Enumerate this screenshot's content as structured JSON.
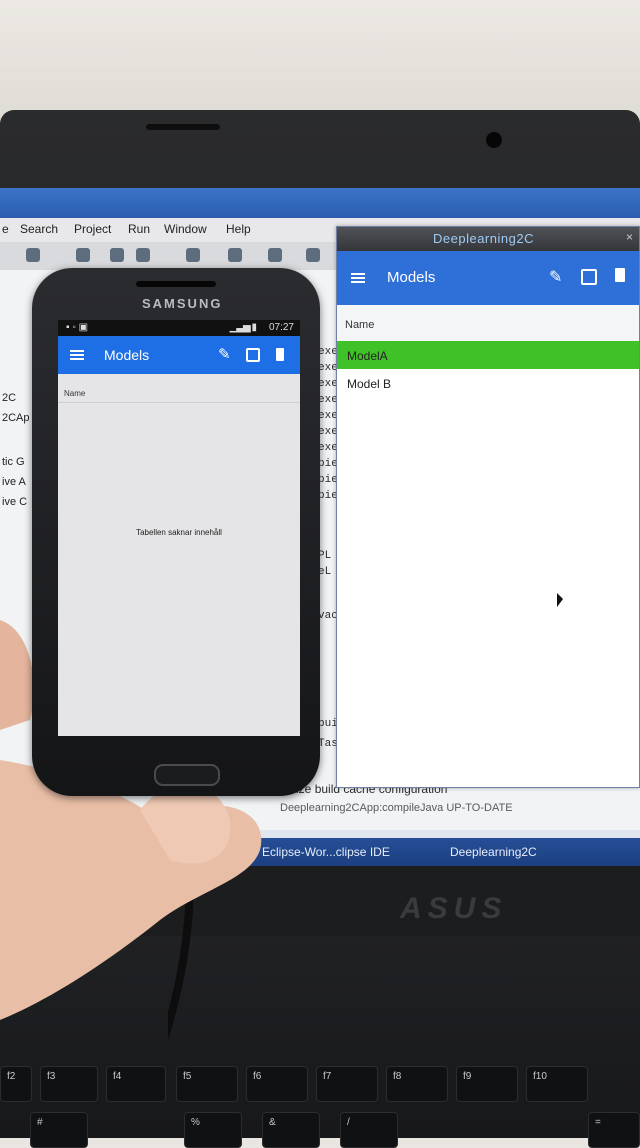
{
  "laptop": {
    "ide": {
      "menu": [
        "e",
        "Search",
        "Project",
        "Run",
        "Window",
        "Help"
      ],
      "left_labels": [
        "2C",
        "2CAp",
        "tic G",
        "ive A",
        "ive C"
      ],
      "console_lines": [
        "exe",
        "exe",
        "exe",
        "exe",
        "exe",
        "exe",
        "exe",
        "pie",
        "pie",
        "pie",
        "PL",
        "eL",
        "vac",
        "buil",
        "Task"
      ],
      "bottom_lines": [
        "nalize build cache configuration",
        "Deeplearning2CApp:compileJava UP-TO-DATE"
      ],
      "taskbar_items": [
        "Eclipse-Wor...clipse IDE",
        "Deeplearning2C"
      ]
    },
    "app_window": {
      "title": "Deeplearning2C",
      "toolbar_title": "Models",
      "column_header": "Name",
      "rows": [
        "ModelA",
        "Model B"
      ],
      "selected_row": 0,
      "accent": "#2f6fd8",
      "selected_color": "#3fc227"
    },
    "brand": "ASUS",
    "keys": [
      "f2",
      "f3",
      "f4",
      "f5",
      "f6",
      "f7",
      "f8",
      "f9",
      "f10",
      "#",
      "%",
      "&",
      "/",
      "="
    ]
  },
  "phone": {
    "brand": "SAMSUNG",
    "status_time": "07:27",
    "toolbar_title": "Models",
    "column_header": "Name",
    "empty_message": "Tabellen saknar innehåll",
    "accent": "#1e6fe6"
  }
}
